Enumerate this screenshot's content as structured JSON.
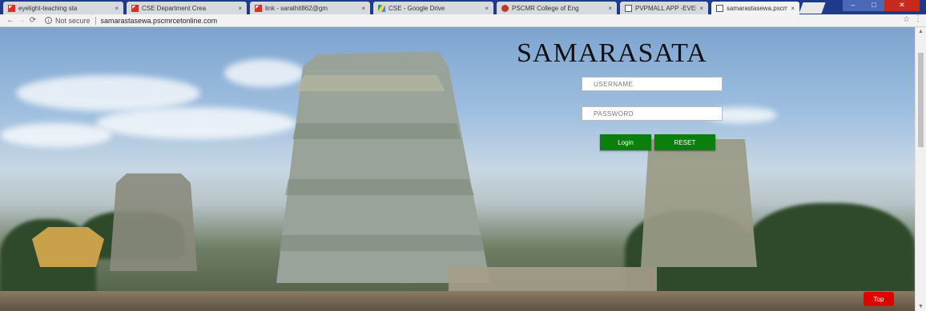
{
  "tabs": [
    {
      "label": "eyelight-teaching sta",
      "icon": "gmail-icon",
      "active": false
    },
    {
      "label": "CSE Department Crea",
      "icon": "gmail-icon",
      "active": false
    },
    {
      "label": "link - sarathit862@gm",
      "icon": "gmail-icon",
      "active": false
    },
    {
      "label": "CSE - Google Drive",
      "icon": "drive-icon",
      "active": false
    },
    {
      "label": "PSCMR College of Eng",
      "icon": "college-icon",
      "active": false
    },
    {
      "label": "PVPMALL APP -EVELI",
      "icon": "document-icon",
      "active": false
    },
    {
      "label": "samarastasewa.pscmr",
      "icon": "document-icon",
      "active": true
    }
  ],
  "tab_close_glyph": "×",
  "address_bar": {
    "security_label": "Not secure",
    "url": "samarastasewa.pscmrcetonline.com"
  },
  "page": {
    "title": "SAMARASATA",
    "username_placeholder": "USERNAME",
    "password_placeholder": "PASSWORD",
    "login_label": "Login",
    "reset_label": "RESET",
    "top_label": "Top"
  },
  "colors": {
    "button_green": "#0b7f0b",
    "top_button_red": "#e00000",
    "tabstrip_blue": "#1f3a8a"
  }
}
